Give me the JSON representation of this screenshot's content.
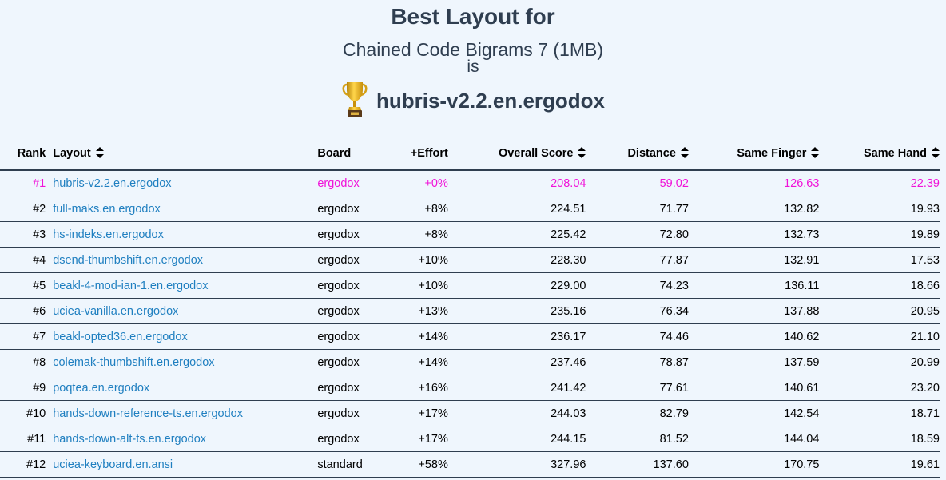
{
  "header": {
    "title": "Best Layout for",
    "corpus": "Chained Code Bigrams 7 (1MB)",
    "is": "is",
    "winner": "hubris-v2.2.en.ergodox",
    "trophy_icon": "trophy-icon"
  },
  "colors": {
    "heading": "#2f3e50",
    "link": "#1f7fc0",
    "best_row": "#f013d9",
    "background": "#eff6fd"
  },
  "table": {
    "columns": {
      "rank": "Rank",
      "layout": "Layout",
      "board": "Board",
      "effort": "+Effort",
      "overall": "Overall Score",
      "distance": "Distance",
      "same_finger": "Same Finger",
      "same_hand": "Same Hand"
    },
    "rows": [
      {
        "rank": "#1",
        "layout": "hubris-v2.2.en.ergodox",
        "board": "ergodox",
        "effort": "+0%",
        "overall": "208.04",
        "distance": "59.02",
        "same_finger": "126.63",
        "same_hand": "22.39"
      },
      {
        "rank": "#2",
        "layout": "full-maks.en.ergodox",
        "board": "ergodox",
        "effort": "+8%",
        "overall": "224.51",
        "distance": "71.77",
        "same_finger": "132.82",
        "same_hand": "19.93"
      },
      {
        "rank": "#3",
        "layout": "hs-indeks.en.ergodox",
        "board": "ergodox",
        "effort": "+8%",
        "overall": "225.42",
        "distance": "72.80",
        "same_finger": "132.73",
        "same_hand": "19.89"
      },
      {
        "rank": "#4",
        "layout": "dsend-thumbshift.en.ergodox",
        "board": "ergodox",
        "effort": "+10%",
        "overall": "228.30",
        "distance": "77.87",
        "same_finger": "132.91",
        "same_hand": "17.53"
      },
      {
        "rank": "#5",
        "layout": "beakl-4-mod-ian-1.en.ergodox",
        "board": "ergodox",
        "effort": "+10%",
        "overall": "229.00",
        "distance": "74.23",
        "same_finger": "136.11",
        "same_hand": "18.66"
      },
      {
        "rank": "#6",
        "layout": "uciea-vanilla.en.ergodox",
        "board": "ergodox",
        "effort": "+13%",
        "overall": "235.16",
        "distance": "76.34",
        "same_finger": "137.88",
        "same_hand": "20.95"
      },
      {
        "rank": "#7",
        "layout": "beakl-opted36.en.ergodox",
        "board": "ergodox",
        "effort": "+14%",
        "overall": "236.17",
        "distance": "74.46",
        "same_finger": "140.62",
        "same_hand": "21.10"
      },
      {
        "rank": "#8",
        "layout": "colemak-thumbshift.en.ergodox",
        "board": "ergodox",
        "effort": "+14%",
        "overall": "237.46",
        "distance": "78.87",
        "same_finger": "137.59",
        "same_hand": "20.99"
      },
      {
        "rank": "#9",
        "layout": "poqtea.en.ergodox",
        "board": "ergodox",
        "effort": "+16%",
        "overall": "241.42",
        "distance": "77.61",
        "same_finger": "140.61",
        "same_hand": "23.20"
      },
      {
        "rank": "#10",
        "layout": "hands-down-reference-ts.en.ergodox",
        "board": "ergodox",
        "effort": "+17%",
        "overall": "244.03",
        "distance": "82.79",
        "same_finger": "142.54",
        "same_hand": "18.71"
      },
      {
        "rank": "#11",
        "layout": "hands-down-alt-ts.en.ergodox",
        "board": "ergodox",
        "effort": "+17%",
        "overall": "244.15",
        "distance": "81.52",
        "same_finger": "144.04",
        "same_hand": "18.59"
      },
      {
        "rank": "#12",
        "layout": "uciea-keyboard.en.ansi",
        "board": "standard",
        "effort": "+58%",
        "overall": "327.96",
        "distance": "137.60",
        "same_finger": "170.75",
        "same_hand": "19.61"
      }
    ]
  }
}
